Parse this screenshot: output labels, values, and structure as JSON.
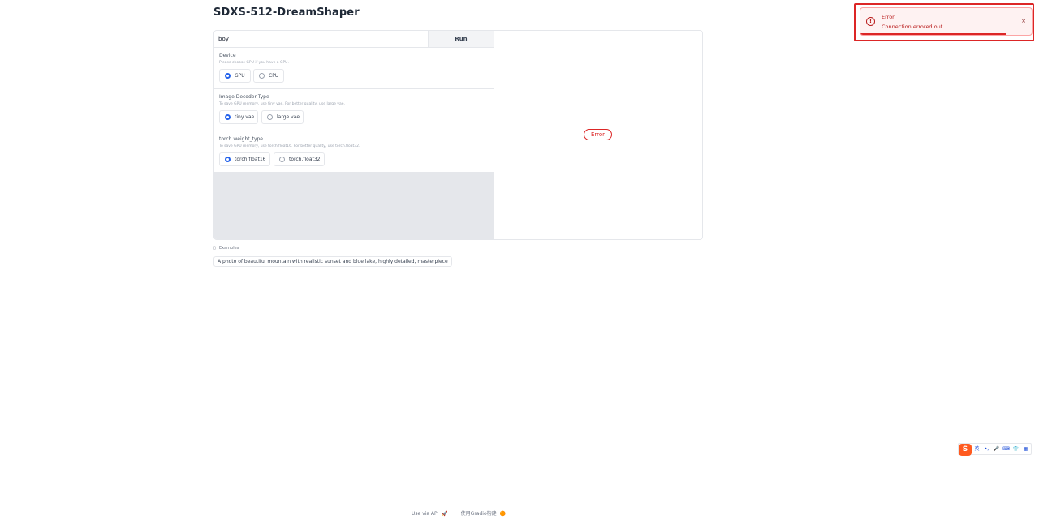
{
  "page": {
    "title": "SDXS-512-DreamShaper"
  },
  "prompt": {
    "value": "boy",
    "run_label": "Run"
  },
  "device": {
    "label": "Device",
    "info": "Please choose GPU if you have a GPU.",
    "options": [
      "GPU",
      "CPU"
    ],
    "selected": "GPU"
  },
  "decoder": {
    "label": "Image Decoder Type",
    "info": "To save GPU memory, use tiny vae. For better quality, use large vae.",
    "options": [
      "tiny vae",
      "large vae"
    ],
    "selected": "tiny vae"
  },
  "weight": {
    "label": "torch.weight_type",
    "info": "To save GPU memory, use torch.float16. For better quality, use torch.float32.",
    "options": [
      "torch.float16",
      "torch.float32"
    ],
    "selected": "torch.float16"
  },
  "output": {
    "status": "Error"
  },
  "examples": {
    "label": "Examples",
    "items": [
      "A photo of beautiful mountain with realistic sunset and blue lake, highly detailed, masterpiece"
    ]
  },
  "toast": {
    "title": "Error",
    "message": "Connection errored out.",
    "close": "×",
    "progress": 0.85
  },
  "ime": {
    "logo": "S",
    "items": [
      "英",
      "•,",
      "🎤",
      "⌨",
      "👕",
      "▦"
    ]
  },
  "footer": {
    "api": "Use via API",
    "sep": "·",
    "built": "使用Gradio构建"
  },
  "colors": {
    "accent": "#2563eb",
    "error": "#dc2626",
    "error_bg": "#fef2f2"
  }
}
